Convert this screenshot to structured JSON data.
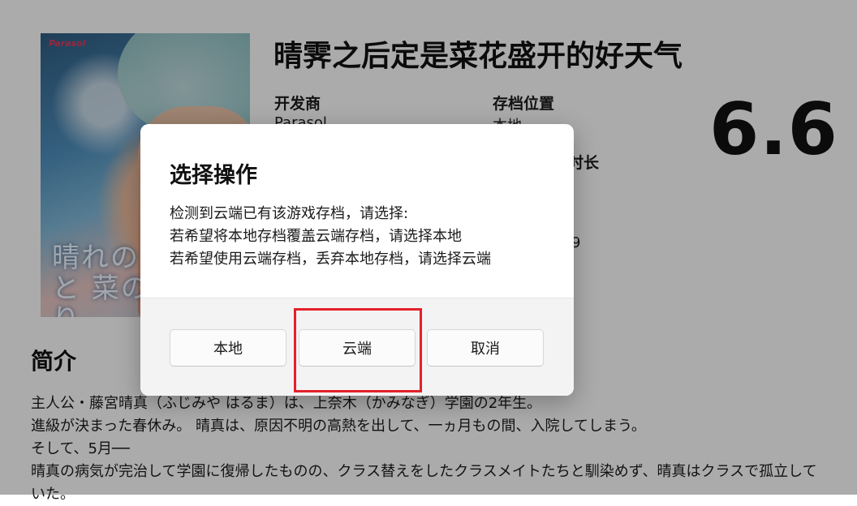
{
  "game": {
    "title": "晴霁之后定是菜花盛开的好天气",
    "cover_logo": "Parasol",
    "cover_title": "晴れのち きっと 菜の花びより",
    "developer_label": "开发商",
    "developer_value": "Parasol",
    "save_location_label": "存档位置",
    "save_location_value": "本地",
    "playtime_label": "时长",
    "partial_number": "9",
    "score": "6.6"
  },
  "intro": {
    "heading": "简介",
    "lines": [
      "主人公・藤宮晴真（ふじみや はるま）は、上奈木（かみなぎ）学園の2年生。",
      "進級が決まった春休み。 晴真は、原因不明の高熱を出して、一ヵ月もの間、入院してしまう。",
      "そして、5月──",
      "晴真の病気が完治して学園に復帰したものの、クラス替えをしたクラスメイトたちと馴染めず、晴真はクラスで孤立して",
      "いた。"
    ]
  },
  "dialog": {
    "title": "选择操作",
    "message_lines": [
      "检测到云端已有该游戏存档，请选择:",
      "若希望将本地存档覆盖云端存档，请选择本地",
      "若希望使用云端存档，丢弃本地存档，请选择云端"
    ],
    "buttons": {
      "local": "本地",
      "cloud": "云端",
      "cancel": "取消"
    }
  },
  "colors": {
    "highlight": "#e3202a",
    "overlay": "rgba(0,0,0,0.33)"
  }
}
